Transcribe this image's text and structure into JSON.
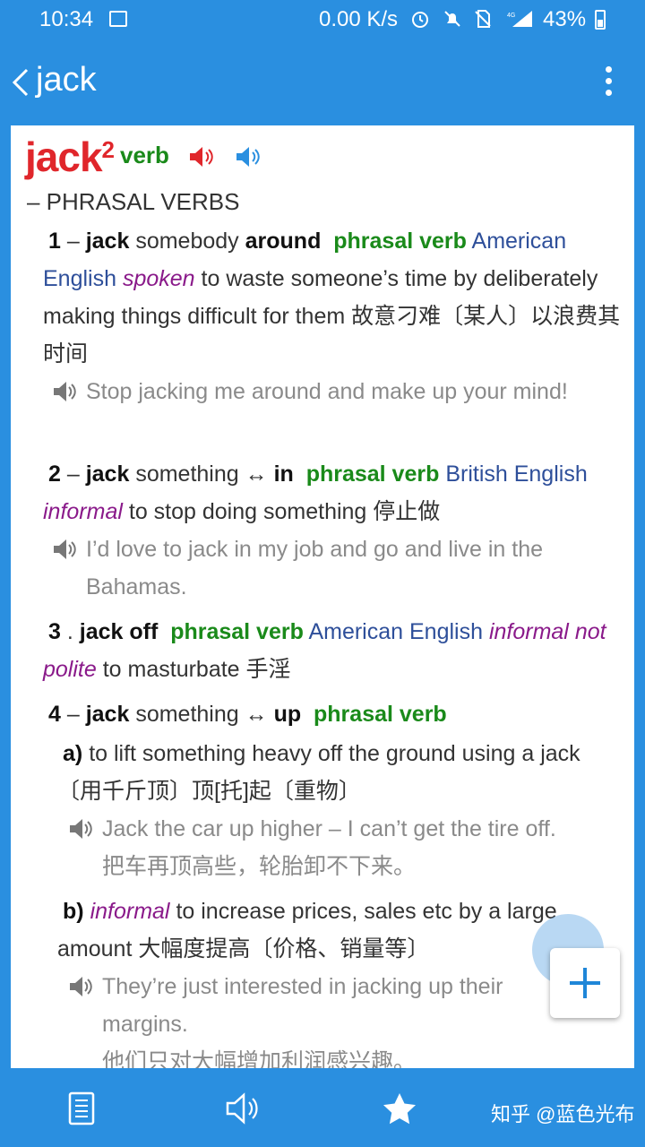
{
  "status_bar": {
    "time": "10:34",
    "net_speed": "0.00 K/s",
    "battery": "43%"
  },
  "app_bar": {
    "title": "jack"
  },
  "entry": {
    "headword": "jack",
    "homograph": "2",
    "pos": "verb",
    "section_title": "– PHRASAL VERBS",
    "senses": [
      {
        "num": "1",
        "sep": " – ",
        "hw": "jack",
        "mid": " somebody ",
        "hw2": "around",
        "label": "phrasal verb",
        "region": "American English",
        "register": "spoken",
        "def": "to waste someone’s time by deliberately making things difficult for them",
        "cn": "故意刁难〔某人〕以浪费其时间",
        "example": "Stop jacking me around and make up your mind!"
      },
      {
        "num": "2",
        "sep": " – ",
        "hw": "jack",
        "mid": " something ↔ ",
        "hw2": "in",
        "label": "phrasal verb",
        "region": "British English",
        "register": "informal",
        "def": "to stop doing something",
        "cn": "停止做",
        "example": "I’d love to jack in my job and go and live in the Bahamas."
      },
      {
        "num": "3",
        "sep": " . ",
        "hw": "jack off",
        "label": "phrasal verb",
        "region": "American English",
        "register": "informal",
        "register2": "not polite",
        "def": "to masturbate",
        "cn": "手淫"
      },
      {
        "num": "4",
        "sep": " – ",
        "hw": "jack",
        "mid": " something ↔ ",
        "hw2": "up",
        "label": "phrasal verb",
        "subs": [
          {
            "label": "a)",
            "def": "to lift something heavy off the ground using a jack",
            "cn": "〔用千斤顶〕顶[托]起〔重物〕",
            "example": "Jack the car up higher – I can’t get the tire off.",
            "example_cn": "把车再顶高些，轮胎卸不下来。"
          },
          {
            "label": "b)",
            "register": "informal",
            "def": "to increase prices, sales etc by a large amount",
            "cn": "大幅度提高〔价格、销量等〕",
            "example": "They’re just interested in jacking up their margins.",
            "example_cn": "他们只对大幅增加利润感兴趣。"
          }
        ]
      }
    ]
  },
  "bottom_bar": {
    "watermark": "知乎 @蓝色光布"
  },
  "colors": {
    "primary": "#2a8fe0",
    "headword": "#e0262b",
    "label_green": "#1a8a1a",
    "region_navy": "#2e4f9a",
    "register_purple": "#8a1a8a"
  },
  "icons": [
    "image-icon",
    "alarm-icon",
    "mute-icon",
    "no-sim-icon",
    "signal-icon",
    "battery-icon",
    "back-icon",
    "more-icon",
    "speaker-icon",
    "list-icon",
    "sound-icon",
    "star-icon",
    "add-icon"
  ]
}
